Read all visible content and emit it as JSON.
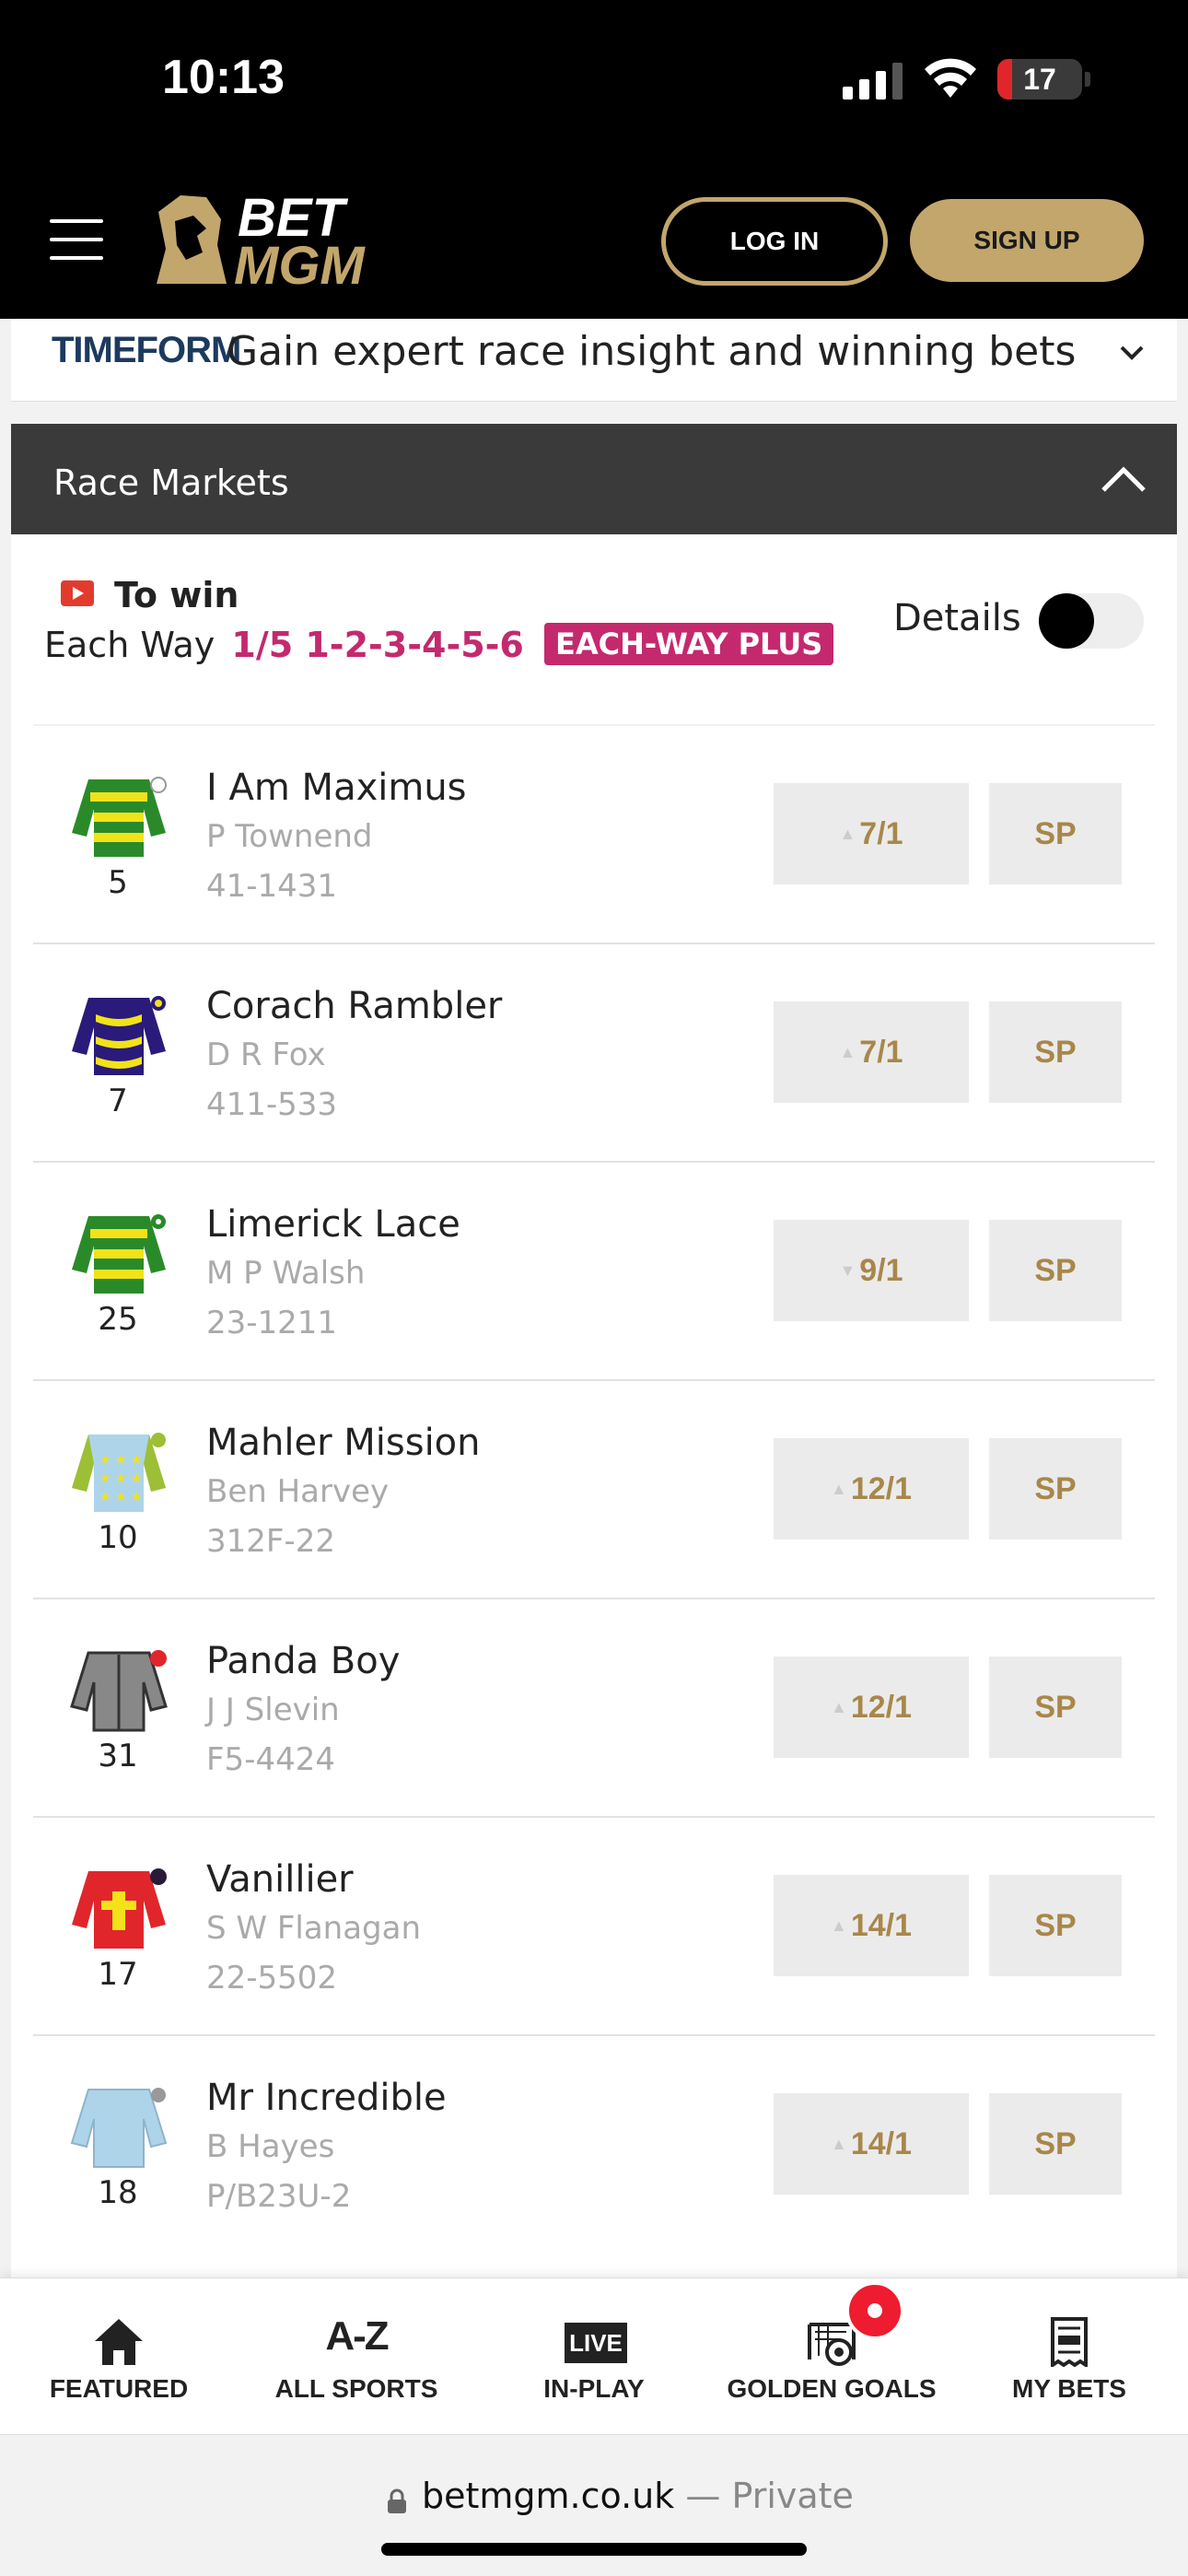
{
  "status_bar": {
    "time": "10:13",
    "battery": "17",
    "battery_level": 0.17
  },
  "header": {
    "menu_icon": "hamburger-icon",
    "logo_text": "BET MGM",
    "login_label": "LOG IN",
    "signup_label": "SIGN UP",
    "accent_color": "#c2a66b"
  },
  "timeform": {
    "logo": "TIMEFORM",
    "text": "Gain expert race insight and winning bets"
  },
  "race_markets": {
    "title": "Race Markets"
  },
  "market": {
    "title": "To win",
    "each_way_label": "Each Way",
    "each_way_terms": "1/5 1-2-3-4-5-6",
    "each_way_badge": "EACH-WAY PLUS",
    "details_label": "Details",
    "details_toggle": false,
    "runners": [
      {
        "number": "5",
        "name": "I Am Maximus",
        "jockey": "P Townend",
        "form": "41-1431",
        "odds": "7/1",
        "trend": "up",
        "sp": "SP"
      },
      {
        "number": "7",
        "name": "Corach Rambler",
        "jockey": "D R Fox",
        "form": "411-533",
        "odds": "7/1",
        "trend": "up",
        "sp": "SP"
      },
      {
        "number": "25",
        "name": "Limerick Lace",
        "jockey": "M P Walsh",
        "form": "23-1211",
        "odds": "9/1",
        "trend": "down",
        "sp": "SP"
      },
      {
        "number": "10",
        "name": "Mahler Mission",
        "jockey": "Ben Harvey",
        "form": "312F-22",
        "odds": "12/1",
        "trend": "up",
        "sp": "SP"
      },
      {
        "number": "31",
        "name": "Panda Boy",
        "jockey": "J J Slevin",
        "form": "F5-4424",
        "odds": "12/1",
        "trend": "up",
        "sp": "SP"
      },
      {
        "number": "17",
        "name": "Vanillier",
        "jockey": "S W Flanagan",
        "form": "22-5502",
        "odds": "14/1",
        "trend": "up",
        "sp": "SP"
      },
      {
        "number": "18",
        "name": "Mr Incredible",
        "jockey": "B Hayes",
        "form": "P/B23U-2",
        "odds": "14/1",
        "trend": "up",
        "sp": "SP"
      }
    ]
  },
  "bottom_nav": {
    "items": [
      {
        "label": "FEATURED",
        "icon": "home-icon"
      },
      {
        "label": "ALL SPORTS",
        "icon": "A-Z"
      },
      {
        "label": "IN-PLAY",
        "icon": "LIVE"
      },
      {
        "label": "GOLDEN GOALS",
        "icon": "goal-icon"
      },
      {
        "label": "MY BETS",
        "icon": "betslip-icon"
      }
    ]
  },
  "url_bar": {
    "domain": "betmgm.co.uk",
    "suffix": "— Private"
  }
}
